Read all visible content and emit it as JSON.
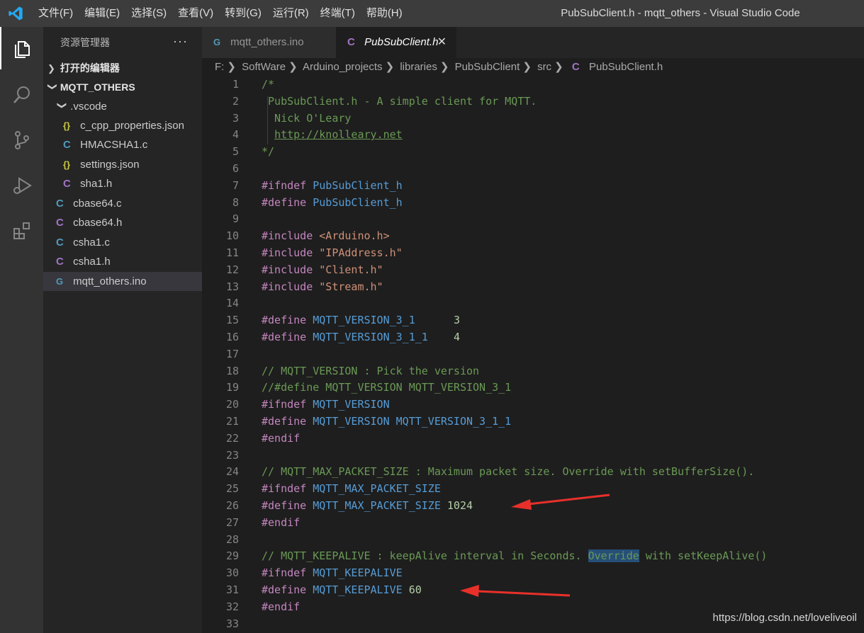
{
  "titlebar": {
    "menus": [
      "文件(F)",
      "编辑(E)",
      "选择(S)",
      "查看(V)",
      "转到(G)",
      "运行(R)",
      "终端(T)",
      "帮助(H)"
    ],
    "window_title": "PubSubClient.h - mqtt_others - Visual Studio Code"
  },
  "activity_icons": [
    "explorer-icon",
    "search-icon",
    "source-control-icon",
    "run-debug-icon",
    "extensions-icon"
  ],
  "sidebar": {
    "title": "资源管理器",
    "more": "···",
    "open_editors": "打开的编辑器",
    "workspace": "MQTT_OTHERS",
    "folder": ".vscode",
    "folder_files": [
      {
        "name": "c_cpp_properties.json",
        "icon": "{}",
        "kind": "json"
      },
      {
        "name": "HMACSHA1.c",
        "icon": "C",
        "kind": "c"
      },
      {
        "name": "settings.json",
        "icon": "{}",
        "kind": "json"
      },
      {
        "name": "sha1.h",
        "icon": "C",
        "kind": "h"
      }
    ],
    "files": [
      {
        "name": "cbase64.c",
        "icon": "C",
        "kind": "c"
      },
      {
        "name": "cbase64.h",
        "icon": "C",
        "kind": "h"
      },
      {
        "name": "csha1.c",
        "icon": "C",
        "kind": "c"
      },
      {
        "name": "csha1.h",
        "icon": "C",
        "kind": "h"
      },
      {
        "name": "mqtt_others.ino",
        "icon": "G",
        "kind": "ino"
      }
    ]
  },
  "tabs": [
    {
      "label": "mqtt_others.ino",
      "icon": "G"
    },
    {
      "label": "PubSubClient.h",
      "icon": "C",
      "close": "✕"
    }
  ],
  "breadcrumb": [
    "F:",
    "SoftWare",
    "Arduino_projects",
    "libraries",
    "PubSubClient",
    "src",
    "PubSubClient.h"
  ],
  "breadcrumb_icon": "C",
  "code": {
    "line_numbers": [
      "1",
      "2",
      "3",
      "4",
      "5",
      "6",
      "7",
      "8",
      "9",
      "10",
      "11",
      "12",
      "13",
      "14",
      "15",
      "16",
      "17",
      "18",
      "19",
      "20",
      "21",
      "22",
      "23",
      "24",
      "25",
      "26",
      "27",
      "28",
      "29",
      "30",
      "31",
      "32",
      "33"
    ],
    "lines": [
      [
        {
          "t": "/*",
          "c": "cm"
        }
      ],
      [
        {
          "t": " PubSubClient.h - A simple client for MQTT.",
          "c": "cm"
        }
      ],
      [
        {
          "t": "  Nick O'Leary",
          "c": "cm"
        }
      ],
      [
        {
          "t": "  ",
          "c": "cm"
        },
        {
          "t": "http://knolleary.net",
          "c": "link"
        }
      ],
      [
        {
          "t": "*/",
          "c": "cm"
        }
      ],
      [],
      [
        {
          "t": "#ifndef ",
          "c": "kw"
        },
        {
          "t": "PubSubClient_h",
          "c": "mac"
        }
      ],
      [
        {
          "t": "#define ",
          "c": "kw"
        },
        {
          "t": "PubSubClient_h",
          "c": "mac"
        }
      ],
      [],
      [
        {
          "t": "#include ",
          "c": "kw"
        },
        {
          "t": "<Arduino.h>",
          "c": "str"
        }
      ],
      [
        {
          "t": "#include ",
          "c": "kw"
        },
        {
          "t": "\"IPAddress.h\"",
          "c": "str"
        }
      ],
      [
        {
          "t": "#include ",
          "c": "kw"
        },
        {
          "t": "\"Client.h\"",
          "c": "str"
        }
      ],
      [
        {
          "t": "#include ",
          "c": "kw"
        },
        {
          "t": "\"Stream.h\"",
          "c": "str"
        }
      ],
      [],
      [
        {
          "t": "#define ",
          "c": "kw"
        },
        {
          "t": "MQTT_VERSION_3_1",
          "c": "mac"
        },
        {
          "t": "      ",
          "c": ""
        },
        {
          "t": "3",
          "c": "num"
        }
      ],
      [
        {
          "t": "#define ",
          "c": "kw"
        },
        {
          "t": "MQTT_VERSION_3_1_1",
          "c": "mac"
        },
        {
          "t": "    ",
          "c": ""
        },
        {
          "t": "4",
          "c": "num"
        }
      ],
      [],
      [
        {
          "t": "// MQTT_VERSION : Pick the version",
          "c": "cm"
        }
      ],
      [
        {
          "t": "//#define MQTT_VERSION MQTT_VERSION_3_1",
          "c": "cm"
        }
      ],
      [
        {
          "t": "#ifndef ",
          "c": "kw"
        },
        {
          "t": "MQTT_VERSION",
          "c": "mac"
        }
      ],
      [
        {
          "t": "#define ",
          "c": "kw"
        },
        {
          "t": "MQTT_VERSION",
          "c": "mac"
        },
        {
          "t": " ",
          "c": ""
        },
        {
          "t": "MQTT_VERSION_3_1_1",
          "c": "mac"
        }
      ],
      [
        {
          "t": "#endif",
          "c": "kw"
        }
      ],
      [],
      [
        {
          "t": "// MQTT_MAX_PACKET_SIZE : Maximum packet size. Override with setBufferSize().",
          "c": "cm"
        }
      ],
      [
        {
          "t": "#ifndef ",
          "c": "kw"
        },
        {
          "t": "MQTT_MAX_PACKET_SIZE",
          "c": "mac"
        }
      ],
      [
        {
          "t": "#define ",
          "c": "kw"
        },
        {
          "t": "MQTT_MAX_PACKET_SIZE",
          "c": "mac"
        },
        {
          "t": " ",
          "c": ""
        },
        {
          "t": "1024",
          "c": "num"
        }
      ],
      [
        {
          "t": "#endif",
          "c": "kw"
        }
      ],
      [],
      [
        {
          "t": "// MQTT_KEEPALIVE : keepAlive interval in Seconds. ",
          "c": "cm"
        },
        {
          "t": "Override",
          "c": "cm hl"
        },
        {
          "t": " with setKeepAlive()",
          "c": "cm"
        }
      ],
      [
        {
          "t": "#ifndef ",
          "c": "kw"
        },
        {
          "t": "MQTT_KEEPALIVE",
          "c": "mac"
        }
      ],
      [
        {
          "t": "#define ",
          "c": "kw"
        },
        {
          "t": "MQTT_KEEPALIVE",
          "c": "mac"
        },
        {
          "t": " ",
          "c": ""
        },
        {
          "t": "60",
          "c": "num"
        }
      ],
      [
        {
          "t": "#endif",
          "c": "kw"
        }
      ],
      []
    ]
  },
  "watermark": "https://blog.csdn.net/loveliveoil",
  "colors": {
    "annotation_arrow": "#e8302a",
    "accent": "#007acc"
  }
}
